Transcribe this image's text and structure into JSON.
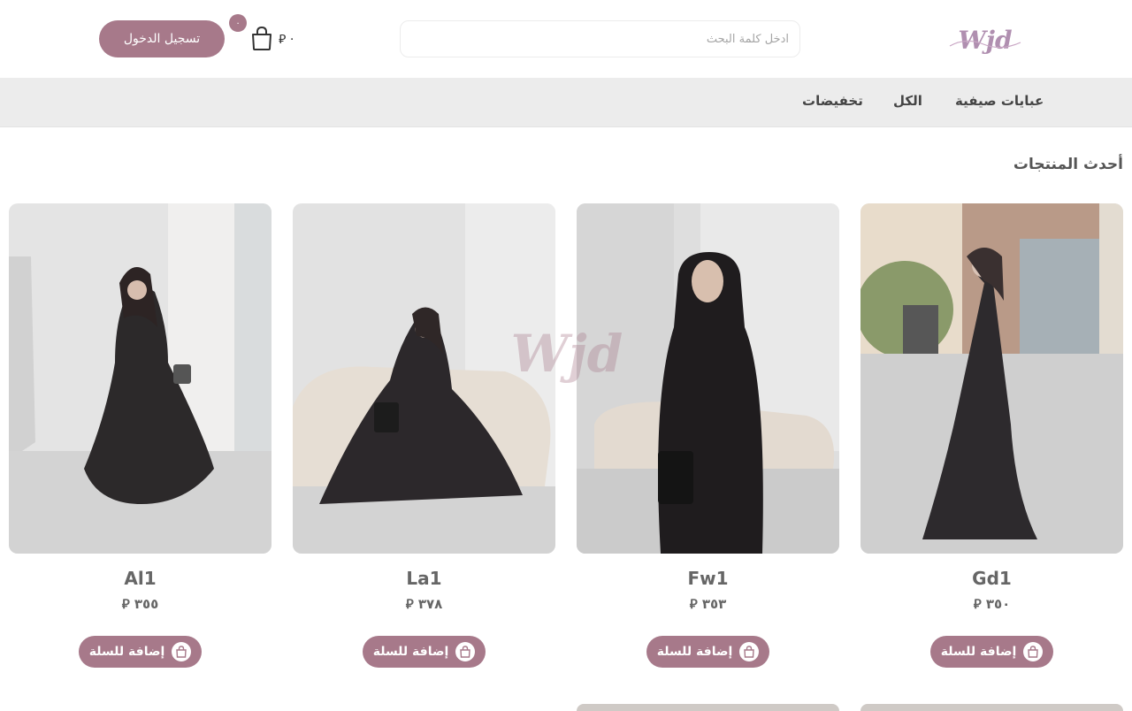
{
  "header": {
    "logo_text": "Wjd",
    "search_placeholder": "ادخل كلمة البحث",
    "cart_total": "٠",
    "cart_count": "٠",
    "login_label": "تسجيل الدخول"
  },
  "nav": {
    "items": [
      {
        "label": "عبايات صيفية"
      },
      {
        "label": "الكل"
      },
      {
        "label": "تخفيضات"
      }
    ]
  },
  "section": {
    "title": "أحدث المنتجات"
  },
  "products": [
    {
      "name": "Gd1",
      "price": "٣٥٠",
      "add_label": "إضافة للسلة"
    },
    {
      "name": "Fw1",
      "price": "٣٥٣",
      "add_label": "إضافة للسلة"
    },
    {
      "name": "La1",
      "price": "٣٧٨",
      "add_label": "إضافة للسلة"
    },
    {
      "name": "Al1",
      "price": "٣٥٥",
      "add_label": "إضافة للسلة"
    }
  ],
  "currency_symbol": "⃁",
  "colors": {
    "accent": "#a7798a",
    "nav_bg": "#ececec"
  },
  "icons": {
    "cart": "shopping-bag-icon",
    "add": "shopping-bag-icon"
  }
}
